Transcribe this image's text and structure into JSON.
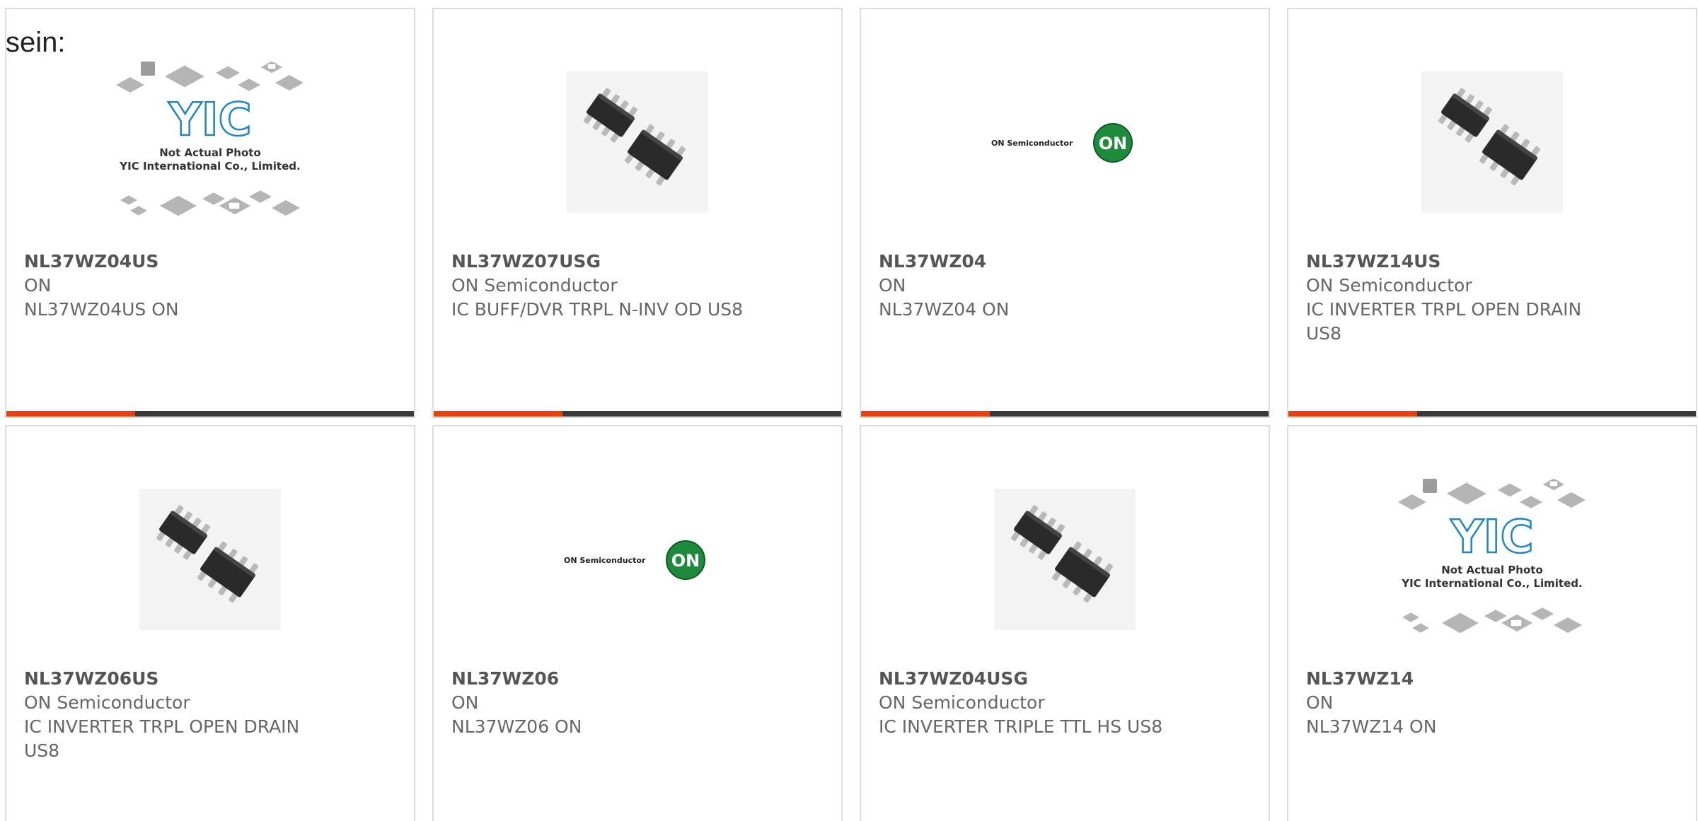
{
  "lead_text": "sein:",
  "colors": {
    "accent": "#e8410b",
    "bar": "#3a3a3a",
    "card_border": "#dcdcdc",
    "text": "#666666",
    "on_logo_green": "#1e8a3c"
  },
  "products": [
    {
      "part": "NL37WZ04US",
      "maker": "ON",
      "desc": "NL37WZ04US ON",
      "image": "placeholder"
    },
    {
      "part": "NL37WZ07USG",
      "maker": "ON Semiconductor",
      "desc": "IC BUFF/DVR TRPL N-INV OD US8",
      "image": "chip"
    },
    {
      "part": "NL37WZ04",
      "maker": "ON",
      "desc": "NL37WZ04 ON",
      "image": "logo"
    },
    {
      "part": "NL37WZ14US",
      "maker": "ON Semiconductor",
      "desc": "IC INVERTER TRPL OPEN DRAIN US8",
      "image": "chip"
    },
    {
      "part": "NL37WZ06US",
      "maker": "ON Semiconductor",
      "desc": "IC INVERTER TRPL OPEN DRAIN US8",
      "image": "chip"
    },
    {
      "part": "NL37WZ06",
      "maker": "ON",
      "desc": "NL37WZ06 ON",
      "image": "logo"
    },
    {
      "part": "NL37WZ04USG",
      "maker": "ON Semiconductor",
      "desc": "IC INVERTER TRIPLE TTL HS US8",
      "image": "chip"
    },
    {
      "part": "NL37WZ14",
      "maker": "ON",
      "desc": "NL37WZ14 ON",
      "image": "placeholder"
    }
  ],
  "placeholder_image": {
    "line1": "Not Actual Photo",
    "line2": "YIC International Co., Limited.",
    "brand": "YIC"
  },
  "logo_image": {
    "wordmark": "ON Semiconductor",
    "badge": "ON"
  }
}
